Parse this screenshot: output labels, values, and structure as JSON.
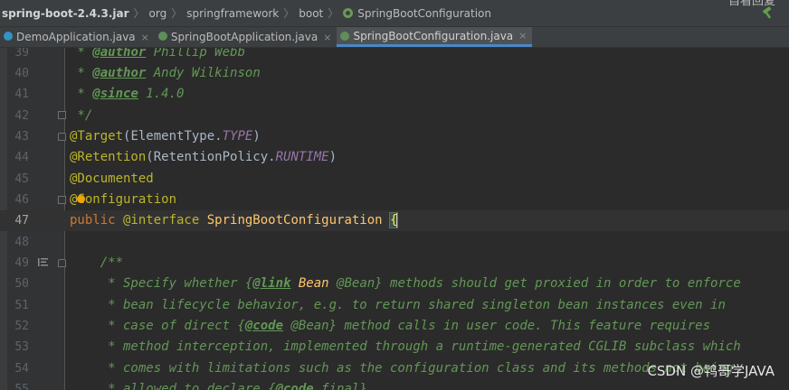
{
  "breadcrumb": {
    "jar": "spring-boot-2.4.3.jar",
    "org": "org",
    "springframework": "springframework",
    "boot": "boot",
    "class": "SpringBootConfiguration"
  },
  "top_right_text": "自看回复",
  "tabs": [
    {
      "label": "DemoApplication.java",
      "active": false
    },
    {
      "label": "SpringBootApplication.java",
      "active": false
    },
    {
      "label": "SpringBootConfiguration.java",
      "active": true
    }
  ],
  "tab_close_glyph": "×",
  "lines": {
    "n39": "39",
    "n40": "40",
    "n41": "41",
    "n42": "42",
    "n43": "43",
    "n44": "44",
    "n45": "45",
    "n46": "46",
    "n47": "47",
    "n48": "48",
    "n49": "49",
    "n50": "50",
    "n51": "51",
    "n52": "52",
    "n53": "53",
    "n54": "54",
    "n55": "55"
  },
  "code": {
    "l39_pre": " * ",
    "l39_tag": "@author",
    "l39_post": " Phillip Webb",
    "l40_pre": " * ",
    "l40_tag": "@author",
    "l40_post": " Andy Wilkinson",
    "l41_pre": " * ",
    "l41_tag": "@since",
    "l41_post": " 1.4.0",
    "l42": " */",
    "l43_ann": "@Target",
    "l43_a": "(ElementType.",
    "l43_const": "TYPE",
    "l43_b": ")",
    "l44_ann": "@Retention",
    "l44_a": "(RetentionPolicy.",
    "l44_const": "RUNTIME",
    "l44_b": ")",
    "l45_ann": "@Documented",
    "l46_ann": "@Configuration",
    "l47_kw": "public",
    "l47_ann": " @interface",
    "l47_sp": " ",
    "l47_cls": "SpringBootConfiguration",
    "l47_sp2": " ",
    "l47_brace": "{",
    "l49": "    /**",
    "l50_pre": "     * Specify whether {",
    "l50_tag": "@link",
    "l50_ref": " Bean",
    "l50_post": " @Bean} methods should get proxied in order to enforce",
    "l51": "     * bean lifecycle behavior, e.g. to return shared singleton bean instances even in",
    "l52_pre": "     * case of direct {",
    "l52_tag": "@code",
    "l52_post": " @Bean} method calls in user code. This feature requires",
    "l53": "     * method interception, implemented through a runtime-generated CGLIB subclass which",
    "l54": "     * comes with limitations such as the configuration class and its methods not being",
    "l55_pre": "     * allowed to declare {",
    "l55_tag": "@code",
    "l55_post": " final}."
  },
  "watermark": "CSDN @鸨哥学JAVA",
  "colors": {
    "background": "#2b2b2b",
    "gutter": "#313335",
    "comment": "#629755",
    "annotation": "#bbb529",
    "keyword": "#cc7832",
    "class_name": "#ffc66d",
    "constant": "#9876aa",
    "text": "#a9b7c6",
    "active_tab_underline": "#4a88c7"
  },
  "icons": [
    "hammer-icon",
    "configuration-class-icon",
    "java-class-icon",
    "fold-marker-icon",
    "intention-bulb-icon",
    "implements-list-icon"
  ]
}
